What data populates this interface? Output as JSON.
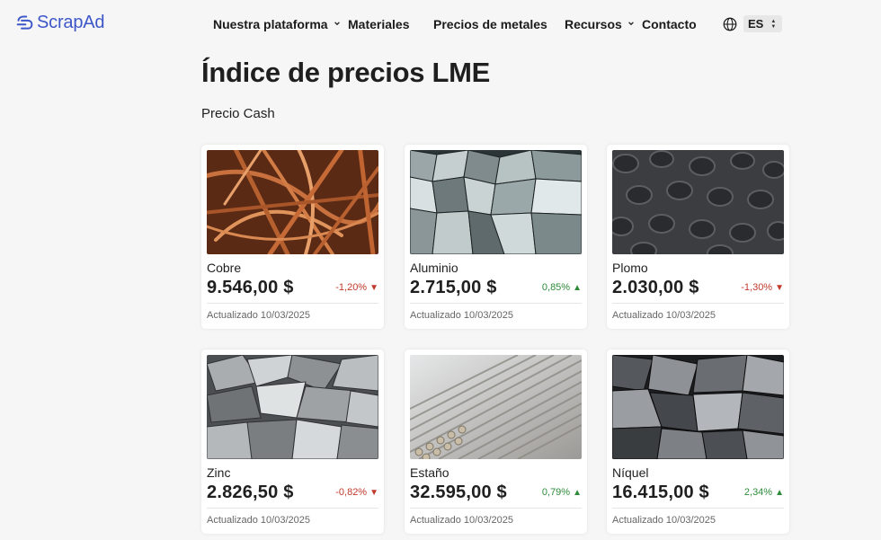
{
  "brand": {
    "name": "ScrapAd",
    "accent": "#3d57c9"
  },
  "nav": {
    "platform": "Nuestra plataforma",
    "materials": "Materiales",
    "prices": "Precios de metales",
    "resources": "Recursos",
    "contact": "Contacto",
    "language": "ES"
  },
  "page": {
    "title": "Índice de precios LME",
    "subtitle": "Precio Cash"
  },
  "cards": [
    {
      "name": "Cobre",
      "price": "9.546,00 $",
      "change": "-1,20%",
      "direction": "down",
      "updated": "Actualizado 10/03/2025",
      "image": "copper-scrap"
    },
    {
      "name": "Aluminio",
      "price": "2.715,00 $",
      "change": "0,85%",
      "direction": "up",
      "updated": "Actualizado 10/03/2025",
      "image": "aluminium-scrap"
    },
    {
      "name": "Plomo",
      "price": "2.030,00 $",
      "change": "-1,30%",
      "direction": "down",
      "updated": "Actualizado 10/03/2025",
      "image": "lead-slugs"
    },
    {
      "name": "Zinc",
      "price": "2.826,50 $",
      "change": "-0,82%",
      "direction": "down",
      "updated": "Actualizado 10/03/2025",
      "image": "zinc-scrap"
    },
    {
      "name": "Estaño",
      "price": "32.595,00 $",
      "change": "0,79%",
      "direction": "up",
      "updated": "Actualizado 10/03/2025",
      "image": "tin-bars"
    },
    {
      "name": "Níquel",
      "price": "16.415,00 $",
      "change": "2,34%",
      "direction": "up",
      "updated": "Actualizado 10/03/2025",
      "image": "nickel-chunks"
    }
  ],
  "colors": {
    "down": "#c0392b",
    "up": "#2e8b3a",
    "background": "#f6f6f6"
  }
}
